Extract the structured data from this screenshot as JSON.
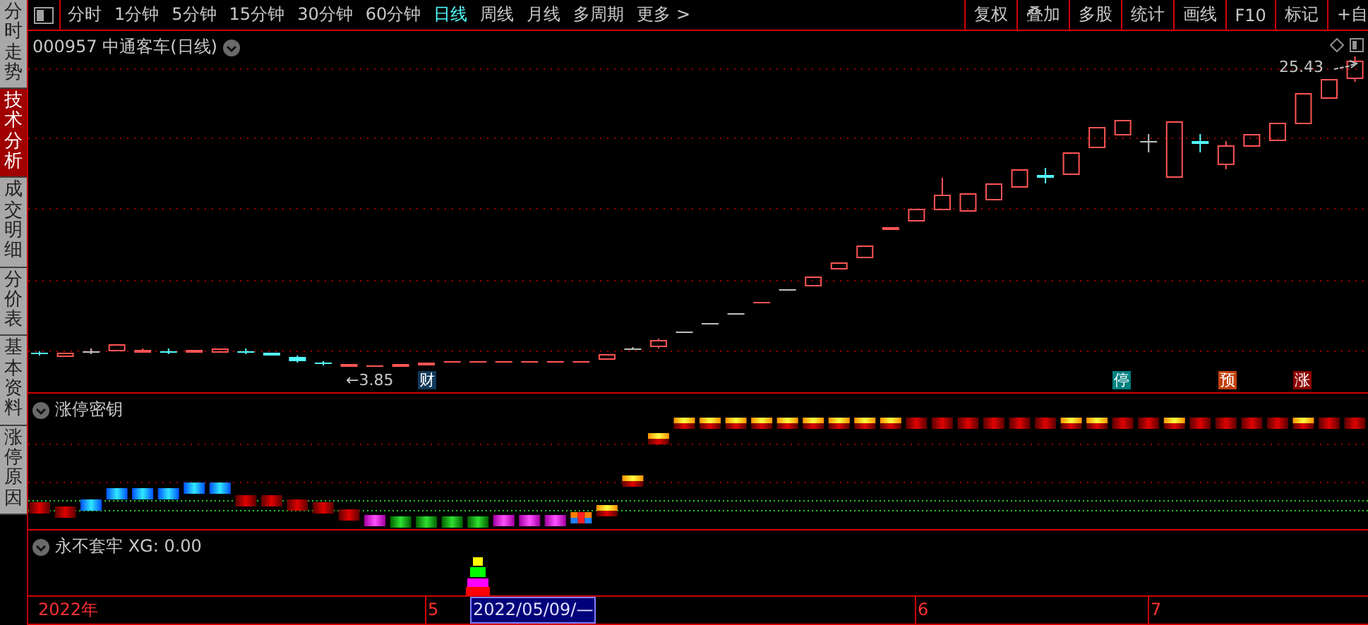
{
  "sidebar": {
    "tabs": [
      {
        "label": "分时走势",
        "selected": false
      },
      {
        "label": "技术分析",
        "selected": true
      },
      {
        "label": "成交明细",
        "selected": false
      },
      {
        "label": "分价表",
        "selected": false
      },
      {
        "label": "基本资料",
        "selected": false
      },
      {
        "label": "涨停原因",
        "selected": false
      }
    ]
  },
  "toolbar": {
    "periods": [
      {
        "label": "分时",
        "selected": false
      },
      {
        "label": "1分钟",
        "selected": false
      },
      {
        "label": "5分钟",
        "selected": false
      },
      {
        "label": "15分钟",
        "selected": false
      },
      {
        "label": "30分钟",
        "selected": false
      },
      {
        "label": "60分钟",
        "selected": false
      },
      {
        "label": "日线",
        "selected": true
      },
      {
        "label": "周线",
        "selected": false
      },
      {
        "label": "月线",
        "selected": false
      },
      {
        "label": "多周期",
        "selected": false
      },
      {
        "label": "更多 >",
        "selected": false
      }
    ],
    "buttons": [
      "复权",
      "叠加",
      "多股",
      "统计",
      "画线",
      "F10",
      "标记",
      "+自"
    ]
  },
  "chart": {
    "title": "000957 中通客车(日线)",
    "high_label": "25.43",
    "low_label": "←3.85",
    "markers": [
      {
        "text": "财",
        "color": "#12385a"
      },
      {
        "text": "停",
        "color": "#008080"
      },
      {
        "text": "预",
        "color": "#c0400c"
      },
      {
        "text": "涨",
        "color": "#8c0000"
      }
    ]
  },
  "indicators": [
    {
      "title": "涨停密钥"
    },
    {
      "title": "永不套牢 XG: 0.00"
    }
  ],
  "time_axis": [
    {
      "label": "2022年",
      "kind": "year"
    },
    {
      "label": "5",
      "kind": "month"
    },
    {
      "label": "2022/05/09/—",
      "kind": "cursor"
    },
    {
      "label": "6",
      "kind": "month"
    },
    {
      "label": "7",
      "kind": "month"
    }
  ]
}
